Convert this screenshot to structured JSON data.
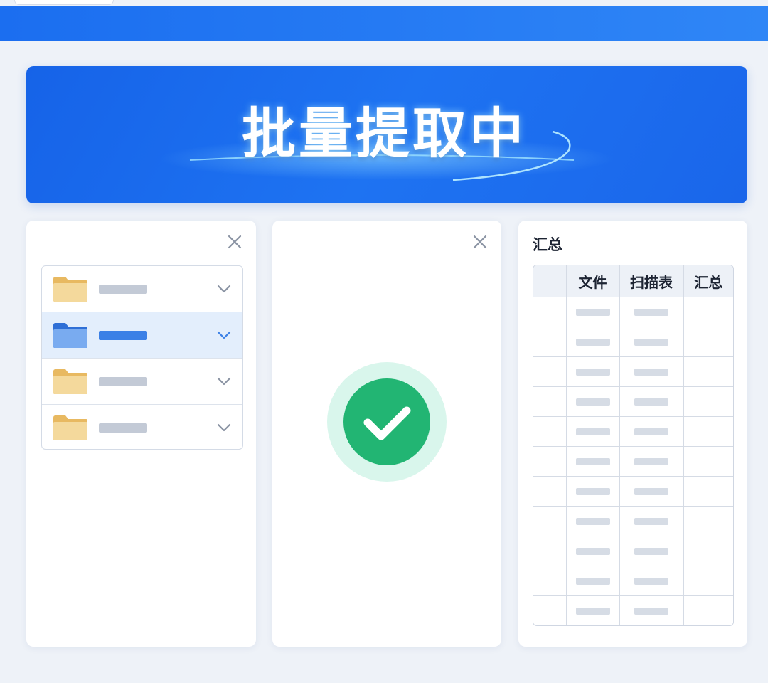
{
  "banner": {
    "title": "批量提取中"
  },
  "colors": {
    "accent": "#1e6ff0",
    "success": "#22b573",
    "folder": "#f1d596",
    "folder_selected": "#6aa4ef"
  },
  "folders": [
    {
      "icon": "folder-icon",
      "selected": false
    },
    {
      "icon": "folder-icon",
      "selected": true
    },
    {
      "icon": "folder-icon",
      "selected": false
    },
    {
      "icon": "folder-icon",
      "selected": false
    }
  ],
  "status": {
    "icon": "check-circle-icon"
  },
  "summary": {
    "title": "汇总",
    "columns": [
      "",
      "文件",
      "扫描表",
      "汇总"
    ],
    "row_count": 11
  }
}
